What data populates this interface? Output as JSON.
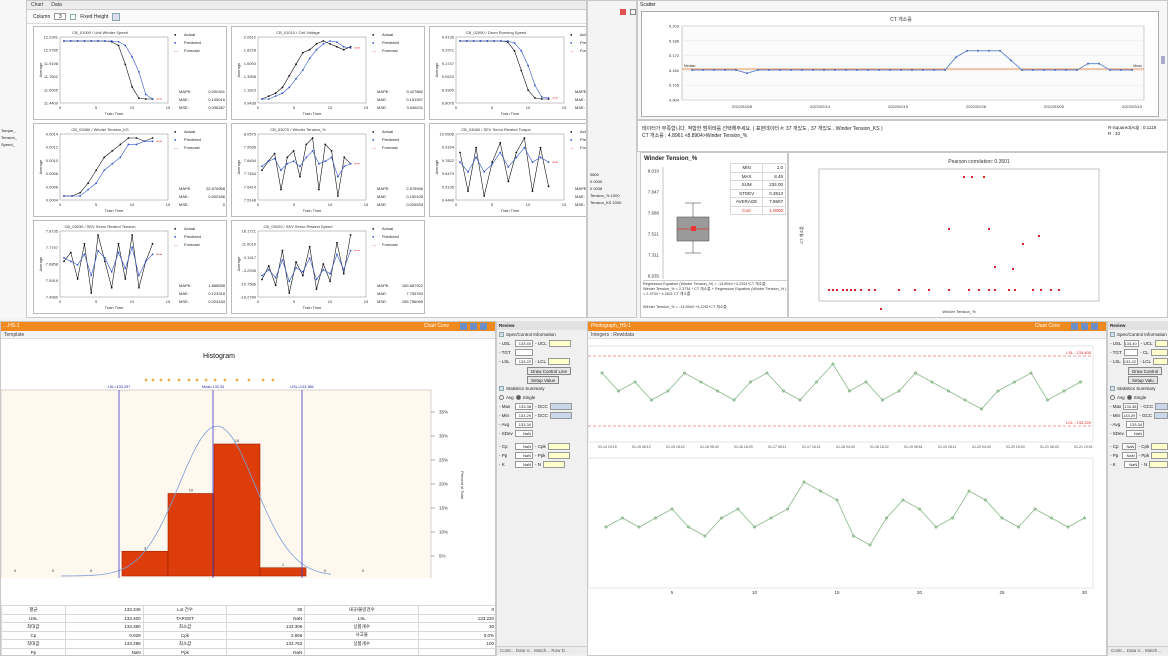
{
  "top_left": {
    "tabs": [
      "Chart",
      "Data"
    ],
    "toolbar": {
      "column_label": "Column",
      "column_value": "3",
      "fixed_height_label": "Fixed Height"
    },
    "legend": [
      "Actual",
      "Predicted",
      "Forecast"
    ],
    "x_axis_label": "Train Time",
    "y_axis_label": "Average",
    "charts": [
      {
        "title": "CB_01000 / Unit Winder Speed",
        "yticks": [
          "12.2391",
          "12.0785",
          "11.9198",
          "11.7602",
          "11.6005",
          "11.4409"
        ],
        "xticks": [
          "0",
          "5",
          "10",
          "15"
        ],
        "stats": [
          [
            "MAPE:",
            "0.000341"
          ],
          [
            "MAE:",
            "0.105016"
          ],
          [
            "MSE:",
            "0.038287"
          ]
        ]
      },
      {
        "title": "CB_01010 / Cell Voltage",
        "yticks": [
          "2.0612",
          "1.8228",
          "1.6093",
          "1.3958",
          "1.1823",
          "0.9438"
        ],
        "xticks": [
          "0",
          "5",
          "10",
          "15"
        ],
        "stats": [
          [
            "MAPE:",
            "9.427882"
          ],
          [
            "MAE:",
            "0.151947"
          ],
          [
            "MSE:",
            "0.048211"
          ]
        ]
      },
      {
        "title": "CB_02050 / Drum Running Speed",
        "yticks": [
          "9.4136",
          "9.2971",
          "9.1747",
          "9.0523",
          "8.9300",
          "8.8076"
        ],
        "xticks": [
          "0",
          "5",
          "10",
          "15"
        ],
        "stats": [
          [
            "MAPE:",
            ""
          ],
          [
            "MAE:",
            ""
          ],
          [
            "MSE:",
            ""
          ]
        ]
      },
      {
        "title": "CB_03080 / Winder Tension_KS",
        "yticks": [
          "0.0014",
          "0.0012",
          "0.0010",
          "0.0008",
          "0.0006",
          "0.0004"
        ],
        "xticks": [
          "0",
          "5",
          "10",
          "15"
        ],
        "stats": [
          [
            "MAPE:",
            "22.676968"
          ],
          [
            "MAE:",
            "0.000186"
          ],
          [
            "MSE:",
            "0"
          ]
        ]
      },
      {
        "title": "CB_03070 / Winder Tension_%",
        "yticks": [
          "8.0575",
          "7.9536",
          "7.8494",
          "7.7454",
          "7.6414",
          "7.5148"
        ],
        "xticks": [
          "0",
          "5",
          "10",
          "15"
        ],
        "stats": [
          [
            "MAPE:",
            "2.576946"
          ],
          [
            "MAE:",
            "0.150105"
          ],
          [
            "MSE:",
            "0.026533"
          ]
        ]
      },
      {
        "title": "CB_03060 / SEV Servo Rewind Torque",
        "yticks": [
          "10.0508",
          "9.9164",
          "9.7822",
          "9.6479",
          "9.5135",
          "9.4440"
        ],
        "xticks": [
          "0",
          "5",
          "10",
          "15"
        ],
        "stats": [
          [
            "MAPE:",
            ""
          ],
          [
            "MAE:",
            ""
          ],
          [
            "MSE:",
            ""
          ]
        ]
      },
      {
        "title": "CB_03030 / SEV Servo Rewind Tension",
        "yticks": [
          "7.8735",
          "7.7797",
          "7.6858",
          "7.5919",
          "7.4980"
        ],
        "xticks": [
          "0",
          "5",
          "10",
          "15"
        ],
        "stats": [
          [
            "MAPE:",
            "1.868558"
          ],
          [
            "MAE:",
            "0.123318"
          ],
          [
            "MSE:",
            "0.024183"
          ]
        ]
      },
      {
        "title": "CB_03020 / SEV Servo Rewind Speed",
        "yticks": [
          "18.1721",
          "11.6019",
          "4.1917",
          "-3.2935",
          "-10.7586",
          "-18.2780"
        ],
        "xticks": [
          "0",
          "5",
          "10",
          "15"
        ],
        "stats": [
          [
            "MAPE:",
            "160.687922"
          ],
          [
            "MAE:",
            "7.759783"
          ],
          [
            "MSE:",
            "159.756099"
          ]
        ]
      }
    ],
    "sidebar_snippets": [
      "Torque_",
      "Tension_",
      "Speed_"
    ]
  },
  "right_top": {
    "tab_label": "Scatter",
    "trend_title": "CT 개소를",
    "trend_yticks": [
      "5.203",
      "5.186",
      "5.170",
      "5.160",
      "5.155",
      "4.904"
    ],
    "trend_xticks": [
      "2022/02/08",
      "2022/02/14",
      "2022/02/19",
      "2022/02/26",
      "2022/03/05",
      "2022/03/10"
    ],
    "trend_labels": {
      "left": "Median",
      "right": "Mean"
    },
    "notice_text": "테이터가 부족합니다. 적합한 범위테를 선택해주세요. ( 표본데이터 #: 37 개있도 , 37 개있도 , Winder Tension_KS )",
    "notice_text2": "CT 개소를 : 4.8961 <8.8904>Winder Tension_%",
    "r_squared": "R-Squared(Adj) : 0.1119",
    "r_small": "R : 33",
    "mid_panel_rows": [
      [
        "0800",
        ""
      ],
      [
        "0",
        "0000"
      ],
      [
        "0",
        "0008"
      ],
      [
        "Tension_%",
        "1000"
      ],
      [
        "Tension_KS",
        "1000"
      ]
    ]
  },
  "box_panel": {
    "title": "Winder Tension_%",
    "yticks": [
      "8.010",
      "7.847",
      "7.686",
      "7.521",
      "7.311",
      "6.935"
    ],
    "stats": [
      [
        "MIN",
        "1.0"
      ],
      [
        "MAX",
        "8.45"
      ],
      [
        "SUM",
        "234.00"
      ],
      [
        "STDEV",
        "0.3913"
      ],
      [
        "AVERAGE",
        "7.8607"
      ],
      [
        "Corr",
        "1.0000"
      ]
    ],
    "reg_text1": "Regression Equation (Winder Tension_%) = -13.8944 +4.2251*CT 개소를",
    "reg_text2": "Winder Tension_% = 2.3734 * CT 개소를 + Regression Equation (Winder Tension_% ) = 2.3734 * 4.2611 CT 개소를",
    "reg_text3": "Winder Tension_% = -13.8944 +4.2251*CT 개소를",
    "scatter_title": "Pearson correlation: 0.3501",
    "scatter_xlabel": "Winder Tension_%",
    "scatter_ylabel": "CT 개소를"
  },
  "histogram": {
    "window_title": "...HS-1",
    "sub_title": "Template",
    "chart_button": "Chart Conv",
    "title": "Histogram",
    "xticks": [
      "133.26",
      "133.28",
      "133.30",
      "133.32",
      "133.34",
      "133.36",
      "133.38",
      "133.40",
      "133.42",
      "133.44"
    ],
    "right_ticks": [
      "35%",
      "30%",
      "25%",
      "20%",
      "15%",
      "10%",
      "5%",
      "0%"
    ],
    "right_axis_label": "Percent of Total",
    "lines": [
      {
        "label": "LSL=133.297",
        "x": 133.297
      },
      {
        "label": "Mean:133.34",
        "x": 133.34
      },
      {
        "label": "USL=133.386",
        "x": 133.386
      }
    ],
    "footer": "Cp/Cpk:1.00/1.0 001",
    "footer2": "Histogram",
    "zero_labels": [
      "0",
      "0",
      "0",
      "0",
      "0"
    ],
    "table": [
      [
        "평균",
        "133.346",
        "Lot 건수",
        "30",
        "내규/불량검수",
        "0"
      ],
      [
        "USL",
        "133.400",
        "TARGET",
        "NaN",
        "LSL",
        "133.220"
      ],
      [
        "최대값",
        "133.380",
        "최소값",
        "133.306",
        "상품개수",
        "30"
      ],
      [
        "Cp",
        "0.929",
        "Cpk",
        "2.866",
        "사고율",
        "0.0%"
      ],
      [
        "최대값",
        "133.298",
        "최소값",
        "133.762",
        "상품개수",
        "100"
      ],
      [
        "Pp",
        "NaN",
        "Ppk",
        "NaN",
        "",
        ""
      ]
    ],
    "chart_data": {
      "type": "bar",
      "categories": [
        "133.31",
        "133.33",
        "133.35",
        "133.37"
      ],
      "values": [
        3,
        10,
        16,
        1
      ],
      "xlim": [
        133.26,
        133.44
      ],
      "ylim_right": [
        "0%",
        "35%"
      ]
    }
  },
  "review_left": {
    "title": "Review",
    "spec_header": "Spec/Control Information",
    "rows": [
      [
        "- USL",
        "133.40",
        "- UCL"
      ],
      [
        "- TGT",
        "",
        ""
      ],
      [
        "- LSL",
        "133.22",
        "- LCL"
      ]
    ],
    "draw_button": "Draw Control Line",
    "setup_button": "Setup Value",
    "stats_header": "Statistics Summary",
    "avg_label": "Avg",
    "single_label": "Single",
    "stat_rows": [
      [
        "- Max",
        "133.38",
        "- GCC"
      ],
      [
        "- Min",
        "133.29",
        "- GCC"
      ],
      [
        "- Avg",
        "133.34",
        ""
      ],
      [
        "- SDev",
        "NaN",
        ""
      ]
    ],
    "cp_rows": [
      [
        "- Cp",
        "NaN",
        "- Cpk"
      ],
      [
        "- Pp",
        "NaN",
        "- Ppk"
      ],
      [
        "- K",
        "NaN",
        "- N"
      ]
    ],
    "bottom_tabs": "Contr... Data V... Match... Row D..."
  },
  "control_chart": {
    "window_title": "Photograph_HS-1",
    "sub_title": "Integers : Rewidata",
    "chart_button": "Chart Conv",
    "limits": [
      {
        "label": "LSL : 133.400"
      },
      {
        "label": "LCL : 133.220"
      }
    ],
    "xticks": [
      "01-14 19:15",
      "01-15 06:12",
      "01-15 18:22",
      "01-16 05:43",
      "01-16 16:29",
      "01-17 05:11",
      "01-17 16:21",
      "01-18 04:43",
      "01-18 16:22",
      "01-19 06:51",
      "01-19 18:11",
      "01-20 04:43",
      "01-20 19:04",
      "01-21 06:43",
      "01-21 19:01"
    ],
    "bottom_xticks": [
      "5",
      "10",
      "15",
      "20",
      "25",
      "30"
    ],
    "chart_data": {
      "type": "line",
      "series": [
        {
          "values": [
            133.36,
            133.34,
            133.35,
            133.33,
            133.34,
            133.36,
            133.35,
            133.34,
            133.33,
            133.35,
            133.36,
            133.34,
            133.33,
            133.35,
            133.37,
            133.34,
            133.35,
            133.33,
            133.34,
            133.36,
            133.35,
            133.34,
            133.33,
            133.32,
            133.34,
            133.35,
            133.36,
            133.33,
            133.34,
            133.35
          ]
        },
        {
          "values": [
            133.33,
            133.34,
            133.33,
            133.34,
            133.35,
            133.33,
            133.32,
            133.34,
            133.35,
            133.33,
            133.34,
            133.35,
            133.38,
            133.37,
            133.36,
            133.32,
            133.31,
            133.34,
            133.36,
            133.35,
            133.33,
            133.34,
            133.37,
            133.36,
            133.34,
            133.33,
            133.35,
            133.34,
            133.33,
            133.34
          ]
        }
      ]
    }
  },
  "review_right": {
    "title": "Review",
    "spec_header": "Spec/Control Information",
    "rows": [
      [
        "- USL",
        "133.40",
        "- UCL"
      ],
      [
        "- TGT",
        "",
        "- CL"
      ],
      [
        "- LSL",
        "133.22",
        "- LCL"
      ]
    ],
    "draw_button": "Draw Control",
    "setup_button": "Setup Valu",
    "stats_header": "Statistics Summary",
    "avg_label": "Avg",
    "single_label": "Single",
    "stat_rows": [
      [
        "- Max",
        "133.38",
        "- GCC"
      ],
      [
        "- Min",
        "133.29",
        "- GCC"
      ],
      [
        "- Avg",
        "133.34",
        ""
      ],
      [
        "- SDev",
        "NaN",
        ""
      ]
    ],
    "cp_rows": [
      [
        "- Cp",
        "NaN",
        "- Cpk"
      ],
      [
        "- Pp",
        "NaN",
        "- Ppk"
      ],
      [
        "- K",
        "NaN",
        "- N"
      ]
    ],
    "bottom_tabs": "Contr... Data V... Match..."
  }
}
